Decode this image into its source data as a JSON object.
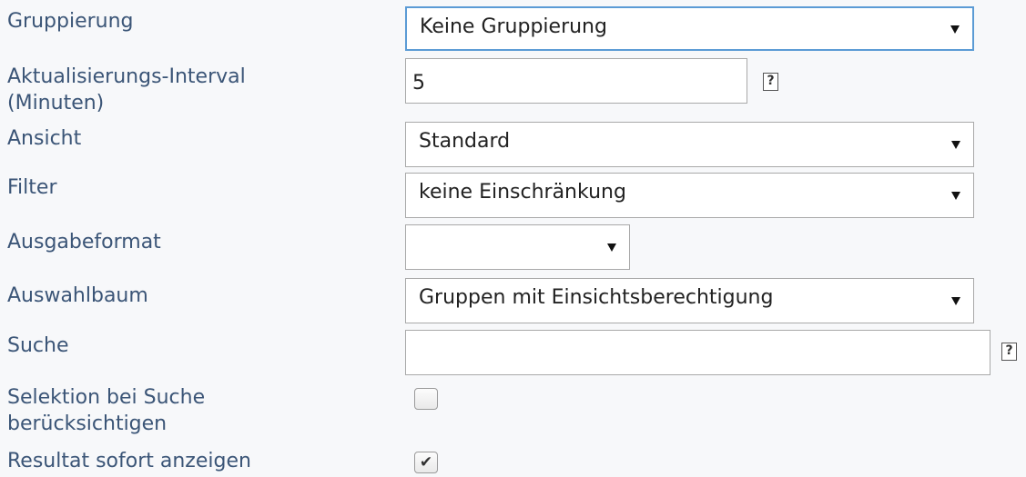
{
  "fields": {
    "gruppierung": {
      "label": "Gruppierung",
      "value": "Keine Gruppierung"
    },
    "intervall": {
      "label": "Aktualisierungs-Interval\n(Minuten)",
      "value": "5"
    },
    "ansicht": {
      "label": "Ansicht",
      "value": "Standard"
    },
    "filter": {
      "label": "Filter",
      "value": "keine Einschränkung"
    },
    "ausgabeformat": {
      "label": "Ausgabeformat",
      "value": ""
    },
    "auswahlbaum": {
      "label": "Auswahlbaum",
      "value": "Gruppen mit Einsichtsberechtigung"
    },
    "suche": {
      "label": "Suche",
      "value": ""
    },
    "selektion": {
      "label": "Selektion bei Suche\nberücksichtigen",
      "checked": false
    },
    "resultat": {
      "label": "Resultat sofort anzeigen",
      "checked": true
    }
  },
  "help_glyph": "?",
  "check_glyph": "✔",
  "colors": {
    "label": "#3b5577",
    "focus_border": "#5b9bd5",
    "background": "#f7f8fa"
  },
  "icons": {
    "help": "help-icon",
    "dropdown": "chevron-down-icon",
    "check": "checkmark-icon"
  }
}
